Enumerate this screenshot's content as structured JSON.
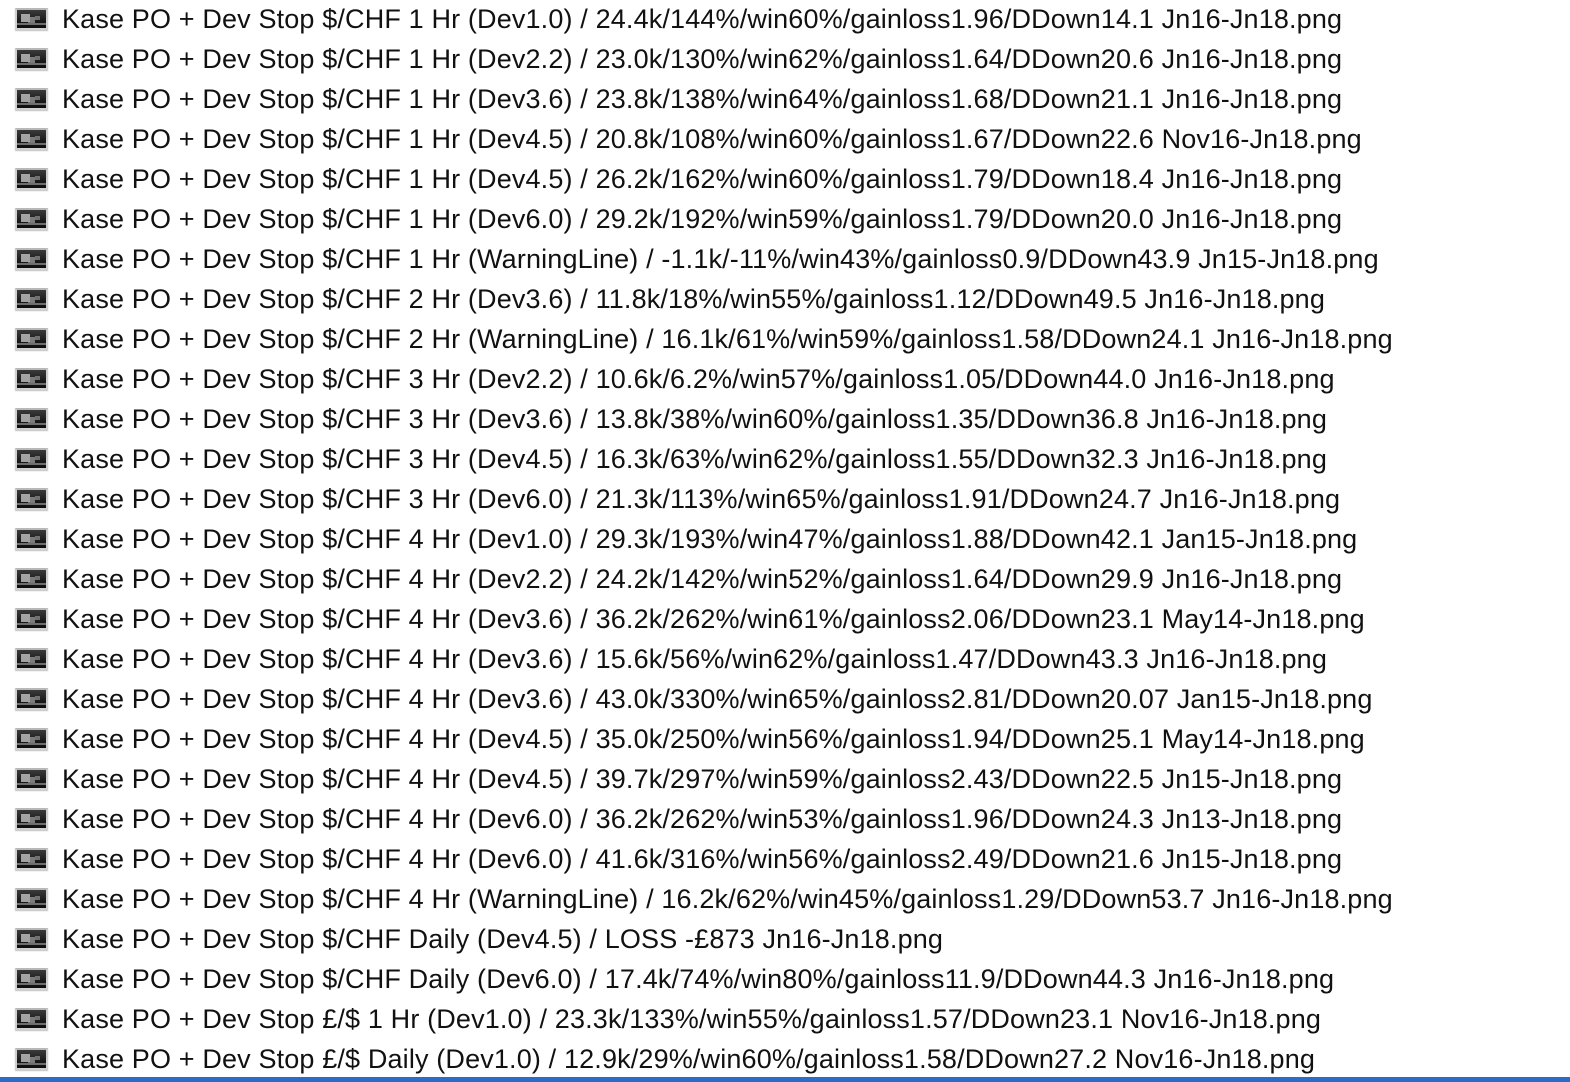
{
  "colors": {
    "background": "#ffffff",
    "text": "#111111",
    "selection_bar": "#2d6bc9"
  },
  "icon": "image-file-icon",
  "files": [
    {
      "name": "Kase PO + Dev Stop $/CHF 1 Hr (Dev1.0) / 24.4k/144%/win60%/gainloss1.96/DDown14.1 Jn16-Jn18.png"
    },
    {
      "name": "Kase PO + Dev Stop $/CHF 1 Hr (Dev2.2) / 23.0k/130%/win62%/gainloss1.64/DDown20.6 Jn16-Jn18.png"
    },
    {
      "name": "Kase PO + Dev Stop $/CHF 1 Hr (Dev3.6) / 23.8k/138%/win64%/gainloss1.68/DDown21.1 Jn16-Jn18.png"
    },
    {
      "name": "Kase PO + Dev Stop $/CHF 1 Hr (Dev4.5) / 20.8k/108%/win60%/gainloss1.67/DDown22.6 Nov16-Jn18.png"
    },
    {
      "name": "Kase PO + Dev Stop $/CHF 1 Hr (Dev4.5) / 26.2k/162%/win60%/gainloss1.79/DDown18.4 Jn16-Jn18.png"
    },
    {
      "name": "Kase PO + Dev Stop $/CHF 1 Hr (Dev6.0) / 29.2k/192%/win59%/gainloss1.79/DDown20.0 Jn16-Jn18.png"
    },
    {
      "name": "Kase PO + Dev Stop $/CHF 1 Hr (WarningLine) / -1.1k/-11%/win43%/gainloss0.9/DDown43.9 Jn15-Jn18.png"
    },
    {
      "name": "Kase PO + Dev Stop $/CHF 2 Hr (Dev3.6) / 11.8k/18%/win55%/gainloss1.12/DDown49.5 Jn16-Jn18.png"
    },
    {
      "name": "Kase PO + Dev Stop $/CHF 2 Hr (WarningLine) / 16.1k/61%/win59%/gainloss1.58/DDown24.1 Jn16-Jn18.png"
    },
    {
      "name": "Kase PO + Dev Stop $/CHF 3 Hr (Dev2.2) / 10.6k/6.2%/win57%/gainloss1.05/DDown44.0 Jn16-Jn18.png"
    },
    {
      "name": "Kase PO + Dev Stop $/CHF 3 Hr (Dev3.6) / 13.8k/38%/win60%/gainloss1.35/DDown36.8 Jn16-Jn18.png"
    },
    {
      "name": "Kase PO + Dev Stop $/CHF 3 Hr (Dev4.5) / 16.3k/63%/win62%/gainloss1.55/DDown32.3 Jn16-Jn18.png"
    },
    {
      "name": "Kase PO + Dev Stop $/CHF 3 Hr (Dev6.0) / 21.3k/113%/win65%/gainloss1.91/DDown24.7 Jn16-Jn18.png"
    },
    {
      "name": "Kase PO + Dev Stop $/CHF 4 Hr (Dev1.0) / 29.3k/193%/win47%/gainloss1.88/DDown42.1 Jan15-Jn18.png"
    },
    {
      "name": "Kase PO + Dev Stop $/CHF 4 Hr (Dev2.2) / 24.2k/142%/win52%/gainloss1.64/DDown29.9 Jn16-Jn18.png"
    },
    {
      "name": "Kase PO + Dev Stop $/CHF 4 Hr (Dev3.6)  / 36.2k/262%/win61%/gainloss2.06/DDown23.1 May14-Jn18.png"
    },
    {
      "name": "Kase PO + Dev Stop $/CHF 4 Hr (Dev3.6) / 15.6k/56%/win62%/gainloss1.47/DDown43.3 Jn16-Jn18.png"
    },
    {
      "name": "Kase PO + Dev Stop $/CHF 4 Hr (Dev3.6) / 43.0k/330%/win65%/gainloss2.81/DDown20.07 Jan15-Jn18.png"
    },
    {
      "name": "Kase PO + Dev Stop $/CHF 4 Hr (Dev4.5)  / 35.0k/250%/win56%/gainloss1.94/DDown25.1 May14-Jn18.png"
    },
    {
      "name": "Kase PO + Dev Stop $/CHF 4 Hr (Dev4.5)  / 39.7k/297%/win59%/gainloss2.43/DDown22.5 Jn15-Jn18.png"
    },
    {
      "name": "Kase PO + Dev Stop $/CHF 4 Hr (Dev6.0) / 36.2k/262%/win53%/gainloss1.96/DDown24.3 Jn13-Jn18.png"
    },
    {
      "name": "Kase PO + Dev Stop $/CHF 4 Hr (Dev6.0) / 41.6k/316%/win56%/gainloss2.49/DDown21.6 Jn15-Jn18.png"
    },
    {
      "name": "Kase PO + Dev Stop $/CHF 4 Hr (WarningLine) / 16.2k/62%/win45%/gainloss1.29/DDown53.7 Jn16-Jn18.png"
    },
    {
      "name": "Kase PO + Dev Stop $/CHF Daily  (Dev4.5) / LOSS -£873 Jn16-Jn18.png"
    },
    {
      "name": "Kase PO + Dev Stop $/CHF Daily (Dev6.0) / 17.4k/74%/win80%/gainloss11.9/DDown44.3 Jn16-Jn18.png"
    },
    {
      "name": "Kase PO + Dev Stop £/$ 1 Hr (Dev1.0) / 23.3k/133%/win55%/gainloss1.57/DDown23.1 Nov16-Jn18.png"
    },
    {
      "name": "Kase PO + Dev Stop £/$ Daily (Dev1.0) / 12.9k/29%/win60%/gainloss1.58/DDown27.2 Nov16-Jn18.png"
    }
  ]
}
